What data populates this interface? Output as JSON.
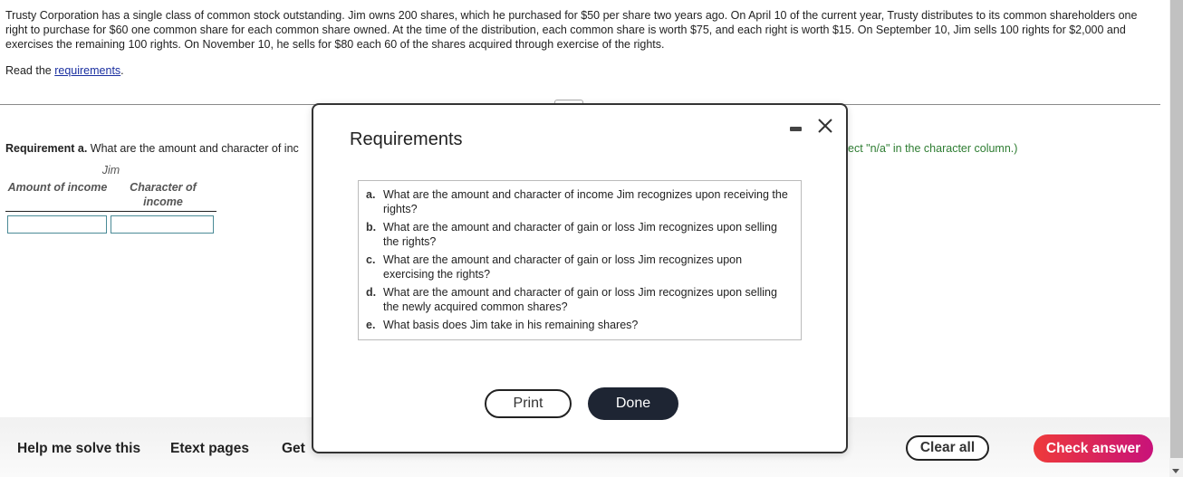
{
  "problem": {
    "text": "Trusty Corporation has a single class of common stock outstanding. Jim owns 200 shares, which he purchased for $50 per share two years ago. On April 10 of the current year, Trusty distributes to its common shareholders one right to purchase for $60 one common share for each common share owned. At the time of the distribution, each common share is worth $75, and each right is worth $15. On September 10, Jim sells 100 rights for $2,000 and exercises the remaining 100 rights. On November 10, he sells for $80 each 60 of the shares acquired through exercise of the rights.",
    "read_prefix": "Read the ",
    "read_link": "requirements",
    "read_suffix": "."
  },
  "requirement": {
    "label": "Requirement a.",
    "question_visible": " What are the amount and character of inc",
    "hint_visible": "ect \"n/a\" in the character column.)"
  },
  "answer_table": {
    "group_header": "Jim",
    "columns": [
      "Amount of income",
      "Character of income"
    ],
    "values": [
      "",
      ""
    ]
  },
  "modal": {
    "title": "Requirements",
    "items": [
      {
        "letter": "a.",
        "text": "What are the amount and character of income Jim recognizes upon receiving the rights?"
      },
      {
        "letter": "b.",
        "text": "What are the amount and character of gain or loss Jim recognizes upon selling the rights?"
      },
      {
        "letter": "c.",
        "text": "What are the amount and character of gain or loss Jim recognizes upon exercising the rights?"
      },
      {
        "letter": "d.",
        "text": "What are the amount and character of gain or loss Jim recognizes upon selling the newly acquired common shares?"
      },
      {
        "letter": "e.",
        "text": "What basis does Jim take in his remaining shares?"
      }
    ],
    "print_label": "Print",
    "done_label": "Done",
    "minimize_icon": "minimize-icon",
    "close_icon": "close-icon"
  },
  "footer": {
    "help_label": "Help me solve this",
    "etext_label": "Etext pages",
    "get_label_visible": "Get",
    "clear_label": "Clear all",
    "check_label": "Check answer"
  },
  "colors": {
    "link": "#1a2fa0",
    "hint": "#2e7d32",
    "done_bg": "#1e2533",
    "check_gradient_start": "#ee3a3a",
    "check_gradient_end": "#c8127a"
  }
}
